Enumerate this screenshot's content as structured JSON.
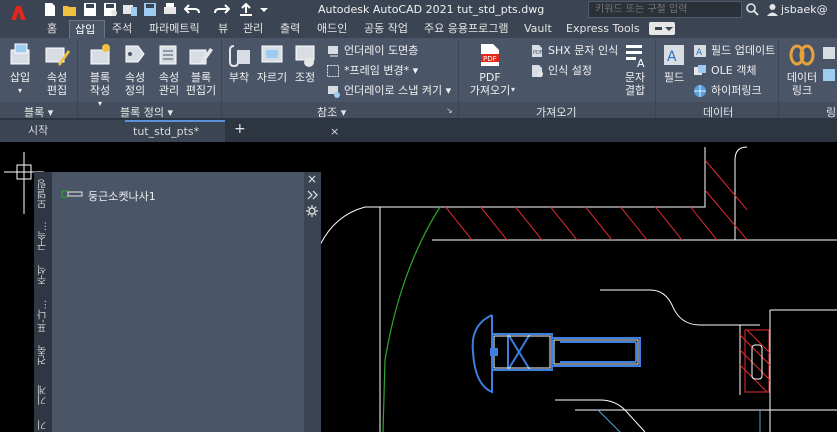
{
  "title_bar": {
    "app_title": "Autodesk AutoCAD 2021    tut_std_pts.dwg",
    "search_placeholder": "키워드 또는 구절 입력",
    "username": "jsbaek@"
  },
  "ribbon_tabs": [
    "홈",
    "삽입",
    "주석",
    "파라메트릭",
    "뷰",
    "관리",
    "출력",
    "애드인",
    "공동 작업",
    "주요 응용프로그램",
    "Vault",
    "Express Tools"
  ],
  "active_tab": "삽입",
  "groups": {
    "block": {
      "label": "블록 ▾",
      "buttons": [
        {
          "label": "삽입",
          "icon": "insert-block-icon"
        },
        {
          "label": "속성\n편집",
          "icon": "edit-attribute-icon"
        }
      ]
    },
    "block_def": {
      "label": "블록 정의 ▾",
      "buttons": [
        {
          "label": "블록\n작성",
          "icon": "create-block-icon"
        },
        {
          "label": "속성\n정의",
          "icon": "define-attribute-icon"
        },
        {
          "label": "속성\n관리",
          "icon": "manage-attribute-icon"
        },
        {
          "label": "블록\n편집기",
          "icon": "block-editor-icon"
        }
      ]
    },
    "reference": {
      "label": "참조 ▾",
      "buttons": [
        {
          "label": "부착",
          "icon": "attach-icon"
        },
        {
          "label": "자르기",
          "icon": "clip-icon"
        },
        {
          "label": "조정",
          "icon": "adjust-icon"
        }
      ],
      "rows": [
        "언더레이 도면층",
        "*프레임 변경* ▾",
        "언더레이로 스냅 켜기 ▾"
      ]
    },
    "import": {
      "label": "가져오기",
      "pdf_label": "PDF\n가져오기",
      "rows": [
        "SHX 문자 인식",
        "인식 설정"
      ],
      "combine_label": "문자\n결합"
    },
    "data": {
      "label": "데이터",
      "field_label": "필드",
      "rows": [
        "필드 업데이트",
        "OLE 객체",
        "하이퍼링크"
      ]
    },
    "link": {
      "label": "링",
      "button_label": "데이터\n링크"
    }
  },
  "doc_tabs": {
    "start": "시작",
    "doc": "tut_std_pts*",
    "close": "×",
    "add": "+"
  },
  "palette": {
    "side_tabs": [
      "모델링",
      "구속...",
      "주석",
      "표-나...",
      "건축",
      "기계",
      "기"
    ],
    "item_name": "둥근소켓나사1",
    "close": "×"
  },
  "colors": {
    "title_bg": "#3b4453",
    "ribbon_bg": "#4a5567",
    "canvas_bg": "#000000",
    "autocad_red": "#e1261c",
    "geometry_white": "#ffffff",
    "hatch_red": "#e32b2b",
    "selection_blue": "#3c7fe0",
    "spline_green": "#2ea82e",
    "centerline_blue": "#4aa3d8"
  }
}
